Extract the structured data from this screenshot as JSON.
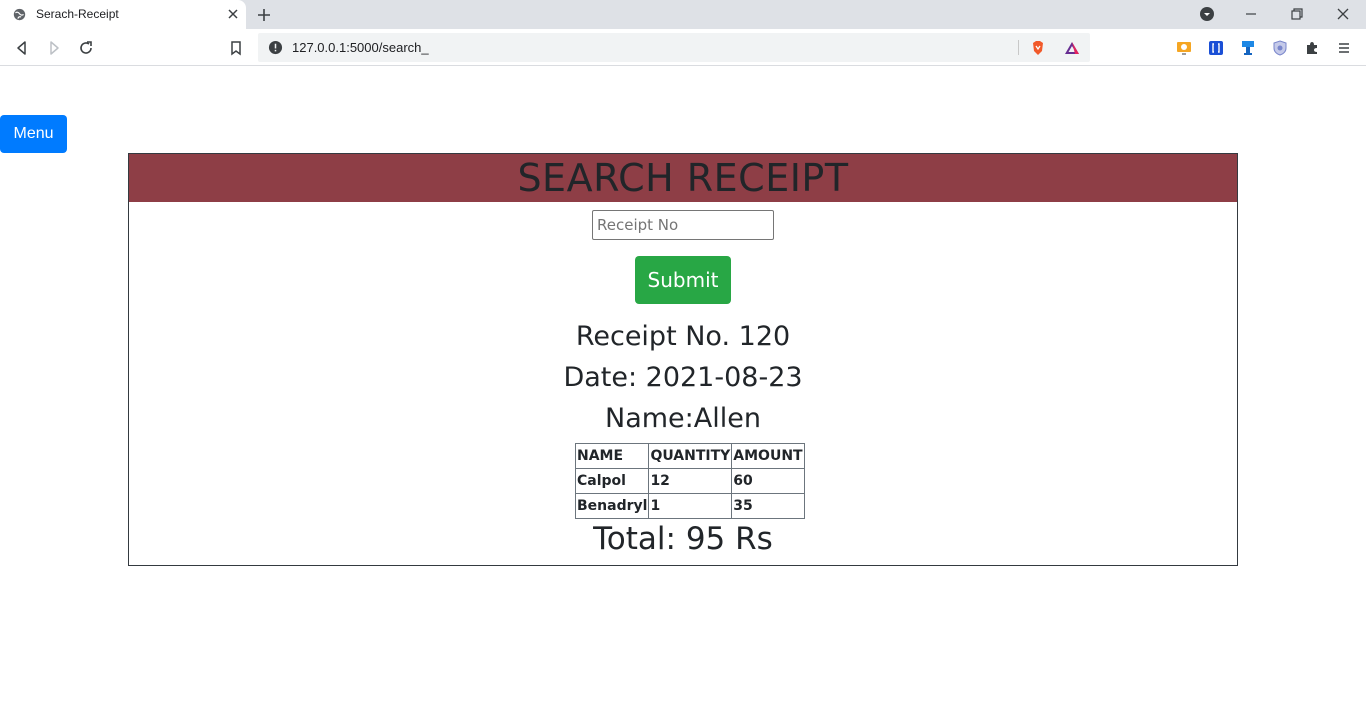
{
  "browser": {
    "tab_title": "Serach-Receipt",
    "url": "127.0.0.1:5000/search_"
  },
  "page": {
    "menu_label": "Menu",
    "header_title": "SEARCH RECEIPT",
    "input_placeholder": "Receipt No",
    "input_value": "",
    "submit_label": "Submit",
    "receipt_line": "Receipt No. 120",
    "date_line": "Date: 2021-08-23",
    "name_line": "Name:Allen",
    "table": {
      "headers": [
        "NAME",
        "QUANTITY",
        "AMOUNT"
      ],
      "rows": [
        [
          "Calpol",
          "12",
          "60"
        ],
        [
          "Benadryl",
          "1",
          "35"
        ]
      ]
    },
    "total_line": "Total: 95 Rs"
  },
  "colors": {
    "header_bg": "#8e3e46",
    "menu_button": "#007bff",
    "submit_button": "#28a745"
  }
}
